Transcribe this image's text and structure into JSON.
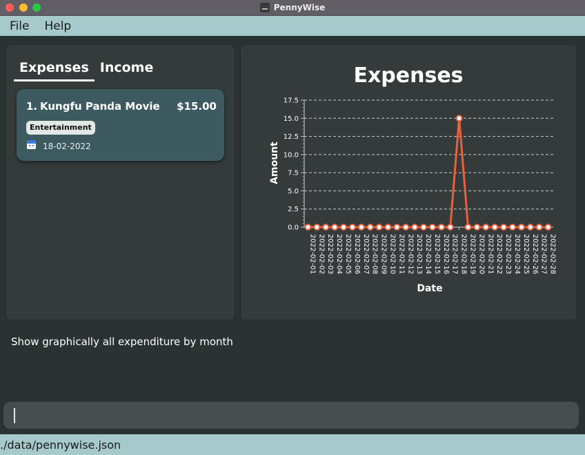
{
  "window": {
    "title": "PennyWise"
  },
  "menu": {
    "items": [
      "File",
      "Help"
    ]
  },
  "tabs": [
    {
      "label": "Expenses",
      "active": true
    },
    {
      "label": "Income",
      "active": false
    }
  ],
  "expenses": [
    {
      "index": "1.",
      "name": "Kungfu Panda Movie",
      "amount": "$15.00",
      "tag": "Entertainment",
      "date": "18-02-2022"
    }
  ],
  "feedback": "Show graphically all expenditure by month",
  "command": {
    "value": ""
  },
  "status": {
    "path": "./data/pennywise.json"
  },
  "colors": {
    "accent": "#e8603c",
    "menu_bg": "#a6c9cc",
    "panel_bg": "#353b3b",
    "card_bg": "#3d5a60"
  },
  "chart_data": {
    "type": "line",
    "title": "Expenses",
    "xlabel": "Date",
    "ylabel": "Amount",
    "ylim": [
      0,
      17.5
    ],
    "yticks": [
      "0.0",
      "2.5",
      "5.0",
      "7.5",
      "10.0",
      "12.5",
      "15.0",
      "17.5"
    ],
    "grid": true,
    "categories": [
      "2022-02-01",
      "2022-02-02",
      "2022-02-03",
      "2022-02-04",
      "2022-02-05",
      "2022-02-06",
      "2022-02-07",
      "2022-02-08",
      "2022-02-09",
      "2022-02-10",
      "2022-02-11",
      "2022-02-12",
      "2022-02-13",
      "2022-02-14",
      "2022-02-15",
      "2022-02-16",
      "2022-02-17",
      "2022-02-18",
      "2022-02-19",
      "2022-02-20",
      "2022-02-21",
      "2022-02-22",
      "2022-02-23",
      "2022-02-24",
      "2022-02-25",
      "2022-02-26",
      "2022-02-27",
      "2022-02-28"
    ],
    "values": [
      0,
      0,
      0,
      0,
      0,
      0,
      0,
      0,
      0,
      0,
      0,
      0,
      0,
      0,
      0,
      0,
      0,
      15,
      0,
      0,
      0,
      0,
      0,
      0,
      0,
      0,
      0,
      0
    ]
  }
}
